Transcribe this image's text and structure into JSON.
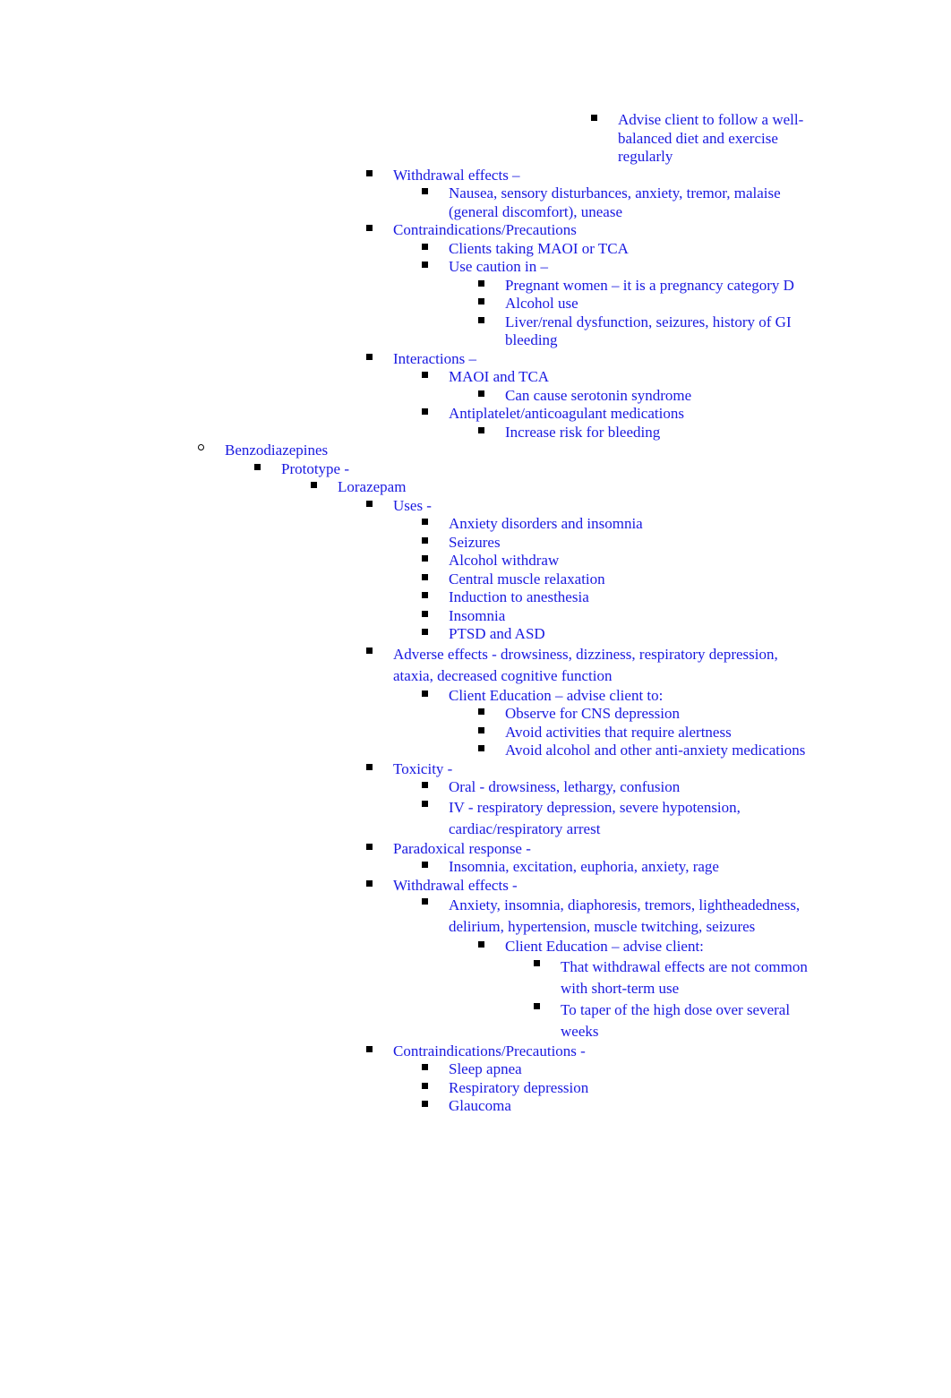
{
  "document": {
    "text_color": "#1a1ae0",
    "bullet_color": "#000000",
    "background": "#ffffff",
    "outline": [
      {
        "id": "advise-diet",
        "level": "g",
        "bullet": "square",
        "text": "Advise client to follow a well-balanced diet and exercise regularly"
      },
      {
        "id": "withdrawal-effects-ssri",
        "level": "c",
        "bullet": "square",
        "text": "Withdrawal effects –"
      },
      {
        "id": "nausea-sensory",
        "level": "d",
        "bullet": "square",
        "text": "Nausea, sensory disturbances, anxiety, tremor, malaise (general discomfort), unease"
      },
      {
        "id": "contraindications-ssri",
        "level": "c",
        "bullet": "square",
        "text": "Contraindications/Precautions"
      },
      {
        "id": "clients-maoi-tca",
        "level": "d",
        "bullet": "square",
        "text": "Clients taking MAOI or TCA"
      },
      {
        "id": "use-caution-in",
        "level": "d",
        "bullet": "square",
        "text": "Use caution in –"
      },
      {
        "id": "pregnant-women",
        "level": "e",
        "bullet": "square",
        "text": "Pregnant women – it is a pregnancy category D"
      },
      {
        "id": "alcohol-use",
        "level": "e",
        "bullet": "square",
        "text": "Alcohol use"
      },
      {
        "id": "liver-renal",
        "level": "e",
        "bullet": "square",
        "text": "Liver/renal dysfunction, seizures, history of GI bleeding"
      },
      {
        "id": "interactions",
        "level": "c",
        "bullet": "square",
        "text": "Interactions –"
      },
      {
        "id": "maoi-and-tca",
        "level": "d",
        "bullet": "square",
        "text": "MAOI and TCA"
      },
      {
        "id": "serotonin-syndrome",
        "level": "e",
        "bullet": "square",
        "text": "Can cause serotonin syndrome"
      },
      {
        "id": "antiplatelet",
        "level": "d",
        "bullet": "square",
        "text": "Antiplatelet/anticoagulant medications"
      },
      {
        "id": "increase-bleeding-risk",
        "level": "e",
        "bullet": "square",
        "text": "Increase risk for bleeding"
      },
      {
        "id": "benzodiazepines",
        "level": "o",
        "bullet": "circle",
        "text": "Benzodiazepines"
      },
      {
        "id": "prototype",
        "level": "a",
        "bullet": "square",
        "text": "Prototype    -"
      },
      {
        "id": "lorazepam",
        "level": "b",
        "bullet": "square",
        "text": "Lorazepam"
      },
      {
        "id": "uses",
        "level": "c",
        "bullet": "square",
        "text": "Uses -"
      },
      {
        "id": "anxiety-insomnia",
        "level": "d",
        "bullet": "square",
        "text": "Anxiety disorders and insomnia"
      },
      {
        "id": "seizures",
        "level": "d",
        "bullet": "square",
        "text": "Seizures"
      },
      {
        "id": "alcohol-withdraw",
        "level": "d",
        "bullet": "square",
        "text": "Alcohol withdraw"
      },
      {
        "id": "central-muscle-relaxation",
        "level": "d",
        "bullet": "square",
        "text": "Central muscle relaxation"
      },
      {
        "id": "induction-anesthesia",
        "level": "d",
        "bullet": "square",
        "text": "Induction to anesthesia"
      },
      {
        "id": "insomnia",
        "level": "d",
        "bullet": "square",
        "text": "Insomnia"
      },
      {
        "id": "ptsd-asd",
        "level": "d",
        "bullet": "square",
        "text": "PTSD and ASD"
      },
      {
        "id": "adverse-effects-benzo",
        "level": "c",
        "bullet": "square",
        "text": "Adverse effects - drowsiness, dizziness, respiratory depression, ataxia, decreased cognitive function",
        "wide_leading": true
      },
      {
        "id": "client-education-advise-to",
        "level": "d",
        "bullet": "square",
        "text": "Client Education – advise client to:"
      },
      {
        "id": "observe-cns-depression",
        "level": "e",
        "bullet": "square",
        "text": "Observe for CNS depression"
      },
      {
        "id": "avoid-activities-alertness",
        "level": "e",
        "bullet": "square",
        "text": "Avoid activities that require alertness"
      },
      {
        "id": "avoid-alcohol",
        "level": "e",
        "bullet": "square",
        "text": "Avoid alcohol and other anti-anxiety medications"
      },
      {
        "id": "toxicity",
        "level": "c",
        "bullet": "square",
        "text": "Toxicity -"
      },
      {
        "id": "toxicity-oral",
        "level": "d",
        "bullet": "square",
        "text": "Oral - drowsiness, lethargy, confusion"
      },
      {
        "id": "toxicity-iv",
        "level": "d",
        "bullet": "square",
        "text": "IV - respiratory depression, severe hypotension, cardiac/respiratory arrest",
        "wide_leading": true
      },
      {
        "id": "paradoxical-response",
        "level": "c",
        "bullet": "square",
        "text": "Paradoxical response -"
      },
      {
        "id": "paradoxical-symptoms",
        "level": "d",
        "bullet": "square",
        "text": "Insomnia, excitation, euphoria, anxiety, rage"
      },
      {
        "id": "withdrawal-effects-benzo",
        "level": "c",
        "bullet": "square",
        "text": "Withdrawal effects -"
      },
      {
        "id": "withdrawal-symptoms-benzo",
        "level": "d",
        "bullet": "square",
        "text": "Anxiety, insomnia, diaphoresis, tremors, lightheadedness, delirium, hypertension, muscle twitching, seizures",
        "wide_leading": true
      },
      {
        "id": "client-education-advise",
        "level": "e",
        "bullet": "square",
        "text": "Client Education – advise client:"
      },
      {
        "id": "withdrawal-not-common",
        "level": "f",
        "bullet": "square",
        "text": "That withdrawal effects are not common with short-term use",
        "wide_leading": true
      },
      {
        "id": "taper-high-dose",
        "level": "f",
        "bullet": "square",
        "text": "To taper of the high dose over several weeks",
        "wide_leading": true
      },
      {
        "id": "contraindications-benzo",
        "level": "c",
        "bullet": "square",
        "text": "Contraindications/Precautions -"
      },
      {
        "id": "sleep-apnea",
        "level": "d",
        "bullet": "square",
        "text": "Sleep apnea"
      },
      {
        "id": "respiratory-depression",
        "level": "d",
        "bullet": "square",
        "text": "Respiratory depression"
      },
      {
        "id": "glaucoma",
        "level": "d",
        "bullet": "square",
        "text": "Glaucoma"
      }
    ]
  }
}
